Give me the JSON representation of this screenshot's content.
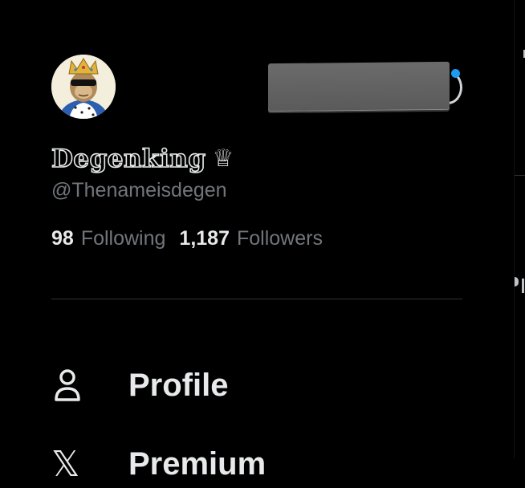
{
  "profile": {
    "display_name": "Degenking",
    "badge_glyph": "♕",
    "handle": "@Thenameisdegen",
    "avatar_icon": "crowned-ape-avatar"
  },
  "stats": {
    "following_count": "98",
    "following_label": "Following",
    "followers_count": "1,187",
    "followers_label": "Followers"
  },
  "nav": {
    "items": [
      {
        "label": "Profile",
        "icon": "person-icon"
      },
      {
        "label": "Premium",
        "icon": "x-logo-icon"
      }
    ]
  },
  "colors": {
    "background": "#000000",
    "primary_text": "#e7e9ea",
    "secondary_text": "#71767b",
    "divider": "#2f3336",
    "accent": "#1d9bf0",
    "redaction": "#616161"
  }
}
